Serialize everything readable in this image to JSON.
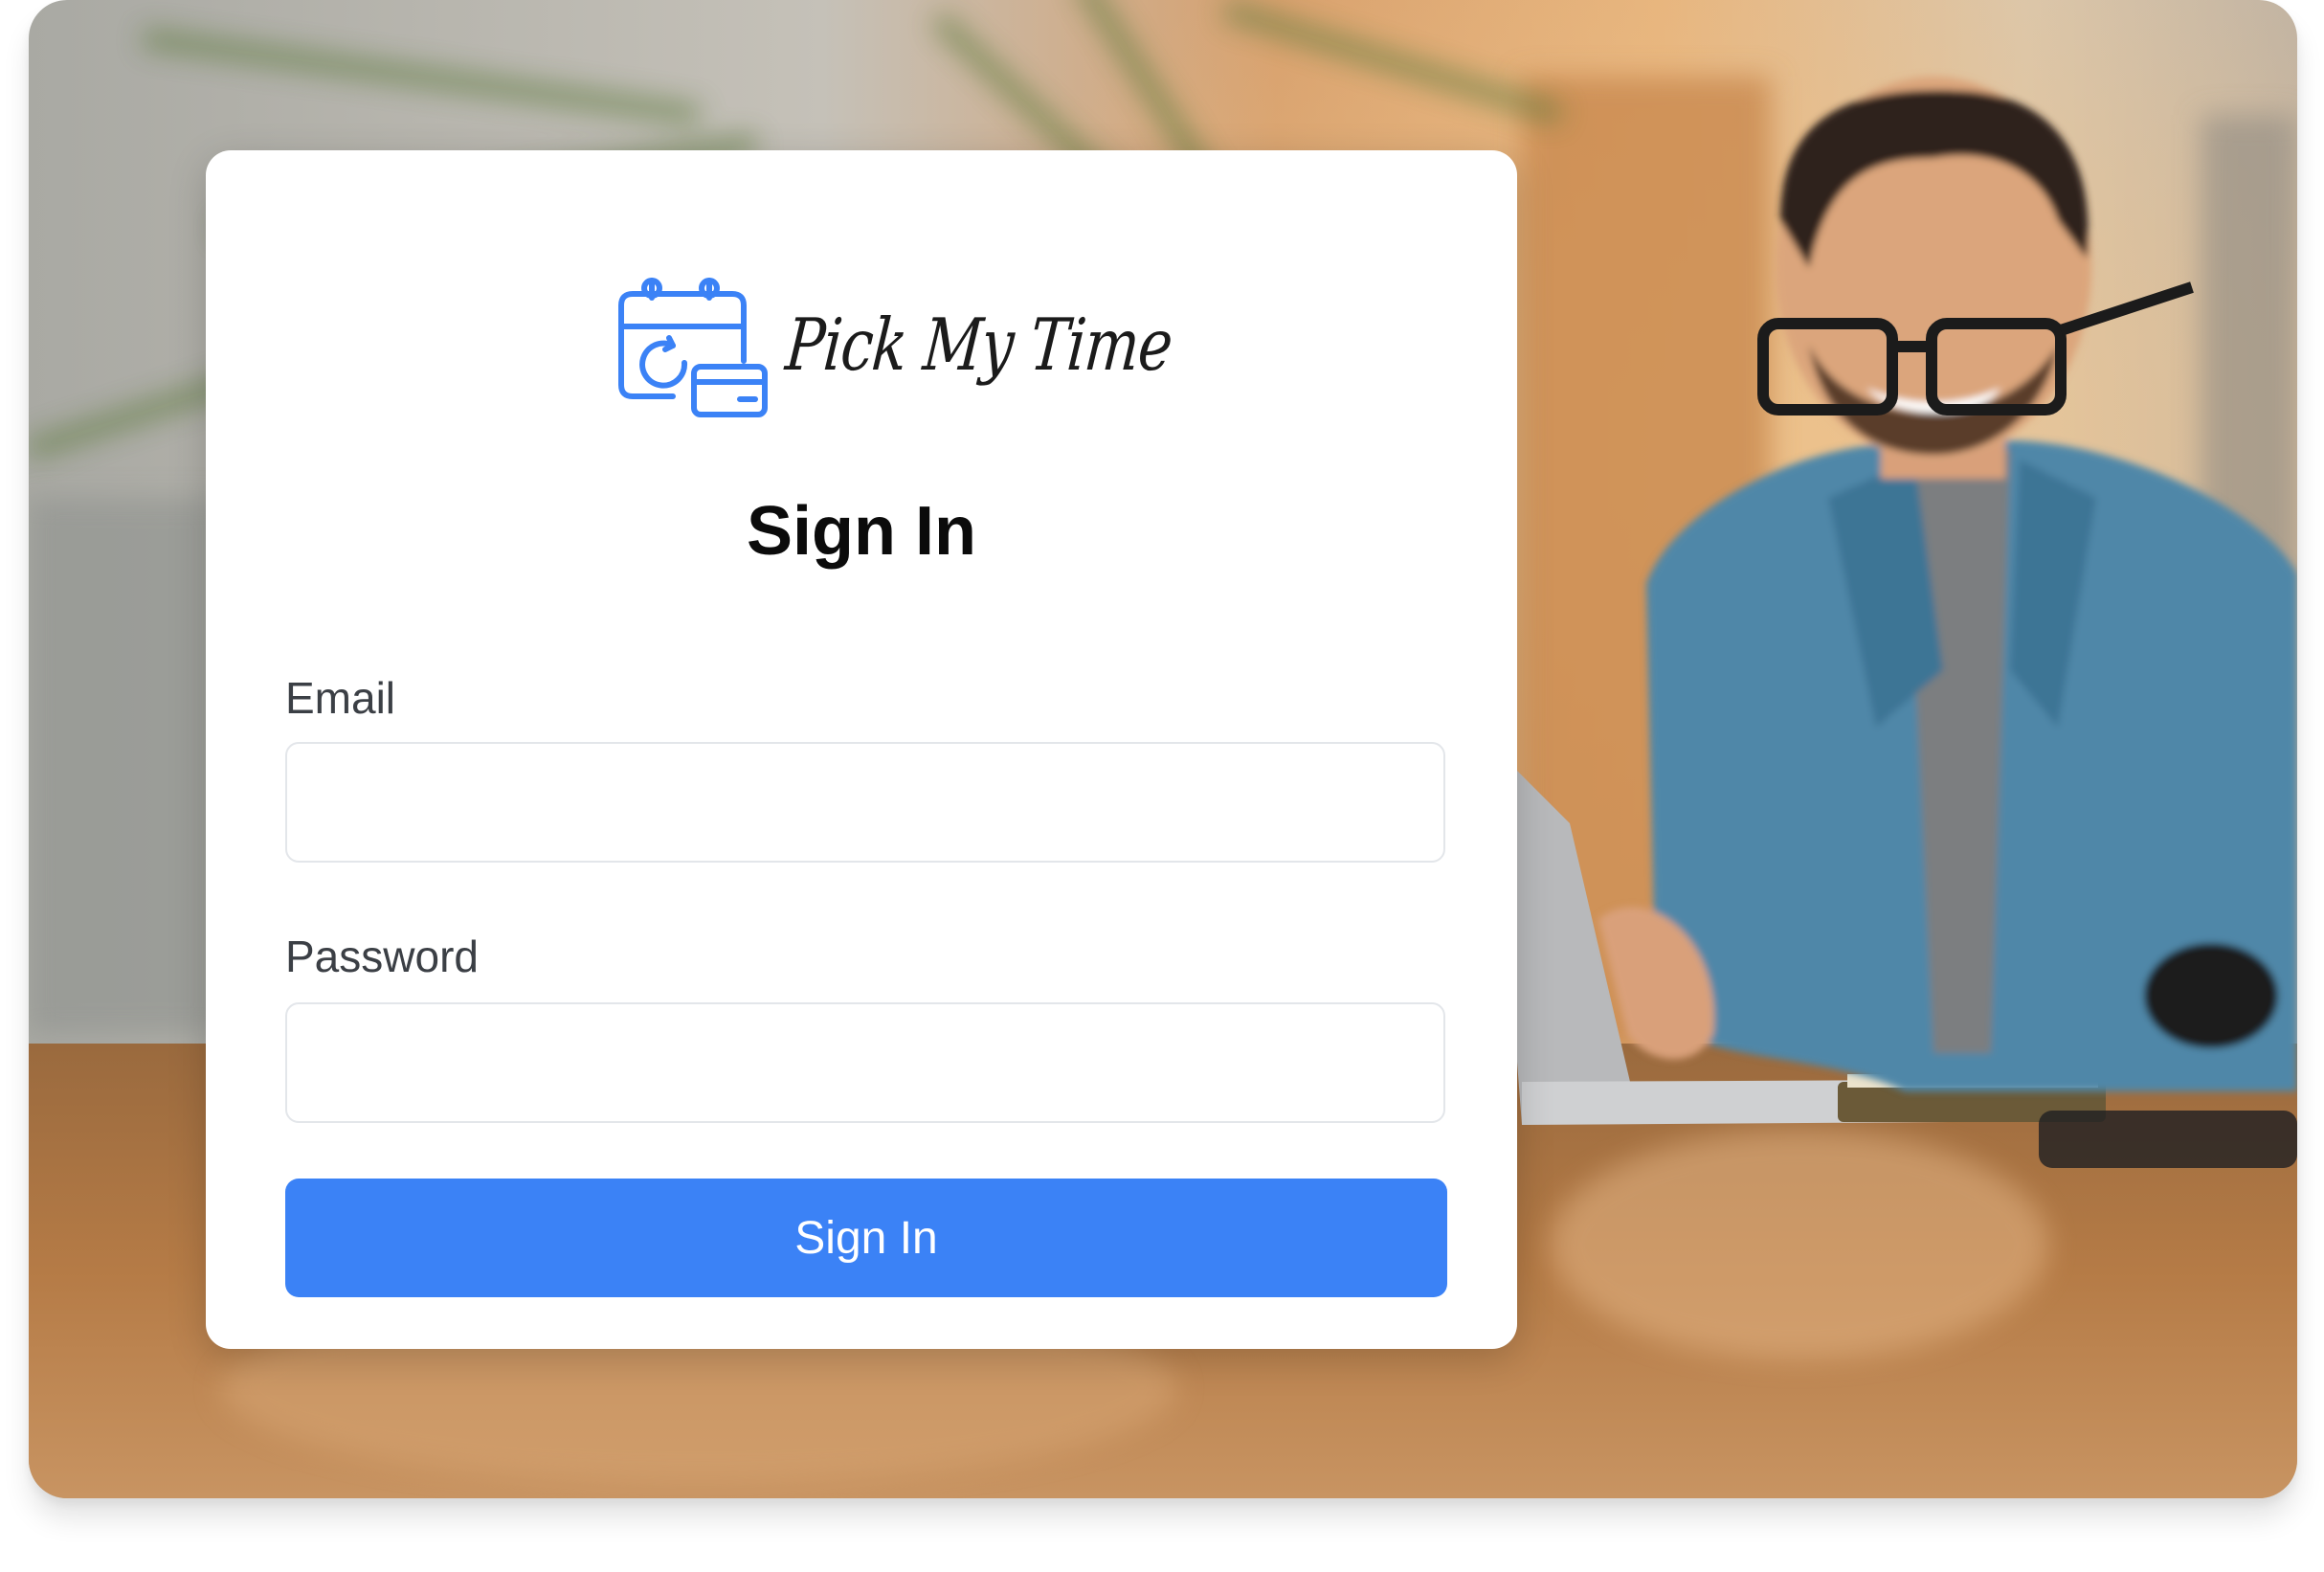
{
  "brand": {
    "name": "Pick My Time",
    "logo_icon": "calendar-refresh-card-icon",
    "accent": "#3b82f6"
  },
  "form": {
    "title": "Sign In",
    "email_label": "Email",
    "email_value": "",
    "password_label": "Password",
    "password_value": "",
    "submit_label": "Sign In"
  },
  "background": {
    "photo": "man-with-laptop-and-coffee-photo"
  }
}
